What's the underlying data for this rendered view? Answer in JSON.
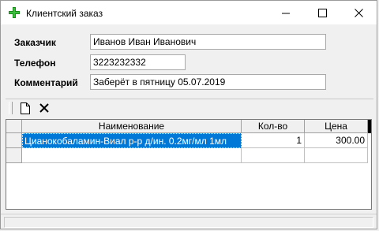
{
  "window": {
    "title": "Клиентский заказ",
    "accent_color": "#1a8a1a"
  },
  "form": {
    "customer_label": "Заказчик",
    "customer_value": "Иванов Иван Иванович",
    "phone_label": "Телефон",
    "phone_value": "3223232332",
    "comment_label": "Комментарий",
    "comment_value": "Заберёт в пятницу 05.07.2019"
  },
  "toolbar": {
    "icons": [
      "new-document-icon",
      "delete-icon"
    ]
  },
  "grid": {
    "columns": [
      "Наименование",
      "Кол-во",
      "Цена"
    ],
    "rows": [
      {
        "name": "Цианокобаламин-Виал р-р д/ин. 0.2мг/мл 1мл",
        "qty": "1",
        "price": "300.00"
      }
    ],
    "selection_color": "#0078d7"
  },
  "statusbar": {
    "text": ""
  }
}
